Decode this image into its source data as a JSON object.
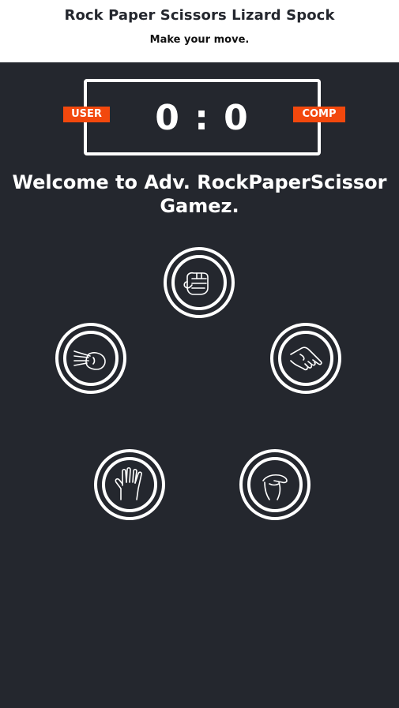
{
  "header": {
    "title": "Rock Paper Scissors Lizard Spock",
    "subtitle": "Make your move."
  },
  "scoreboard": {
    "user_label": "USER",
    "comp_label": "COMP",
    "score": "0 : 0"
  },
  "main": {
    "welcome": "Welcome to Adv. RockPaperScissor Gamez."
  },
  "choices": [
    {
      "name": "rock",
      "icon": "fist-icon"
    },
    {
      "name": "paper",
      "icon": "flat-hand-icon"
    },
    {
      "name": "scissors",
      "icon": "scissors-hand-icon"
    },
    {
      "name": "spock",
      "icon": "vulcan-salute-icon"
    },
    {
      "name": "lizard",
      "icon": "lizard-hand-icon"
    }
  ],
  "colors": {
    "background": "#24272e",
    "accent": "#f2480d",
    "foreground": "#ffffff"
  }
}
